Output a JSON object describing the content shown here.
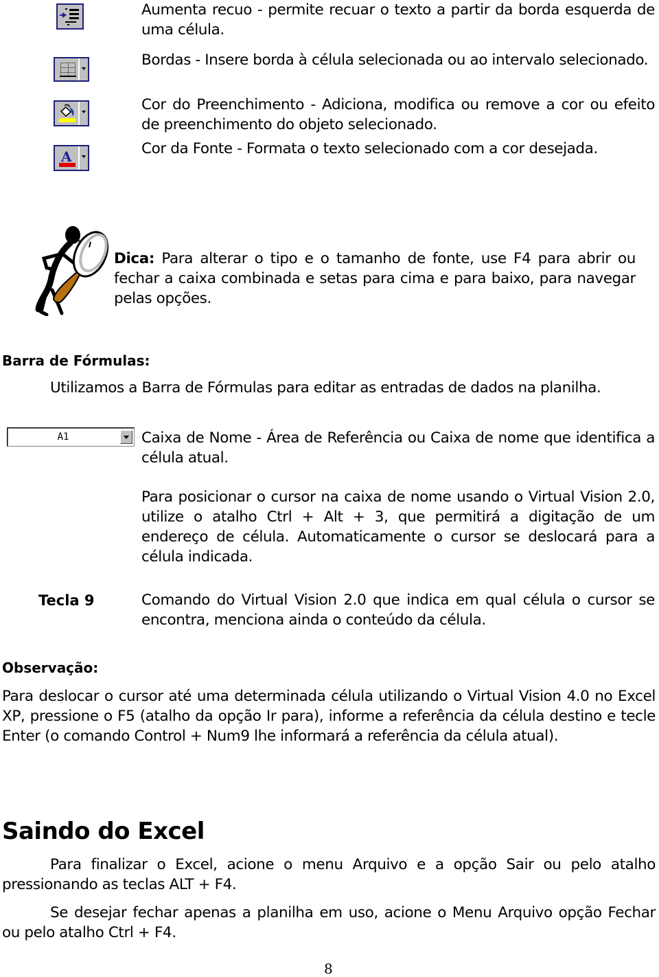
{
  "toolbar_items": [
    {
      "icon": "increase-indent-icon",
      "text": "Aumenta recuo - permite recuar o texto a partir da borda esquerda de uma célula."
    },
    {
      "icon": "borders-icon",
      "text": "Bordas - Insere borda à célula selecionada ou ao intervalo selecionado."
    },
    {
      "icon": "fill-color-icon",
      "text": "Cor do Preenchimento - Adiciona, modifica ou remove a cor ou efeito de preenchimento do objeto selecionado."
    },
    {
      "icon": "font-color-icon",
      "text": "Cor da Fonte - Formata o texto selecionado com a cor desejada."
    }
  ],
  "tip": {
    "icon": "magnifier-figure-icon",
    "label": "Dica:",
    "text": " Para alterar o tipo e o tamanho de fonte, use F4 para abrir ou fechar a caixa combinada e setas para cima e para baixo, para navegar pelas opções."
  },
  "formula_bar": {
    "heading": "Barra de Fórmulas:",
    "intro": "Utilizamos a Barra de Fórmulas para editar as entradas de dados na planilha.",
    "name_box_value": "A1",
    "name_box_desc": "Caixa de Nome - Área de Referência ou Caixa de nome que identifica a célula atual.",
    "name_box_tip": "Para posicionar o cursor na caixa de nome usando o Virtual Vision 2.0, utilize o atalho Ctrl + Alt + 3, que permitirá a digitação de um endereço de célula. Automaticamente o cursor se deslocará para a célula indicada.",
    "key_label": "Tecla 9",
    "key_desc": "Comando do Virtual Vision 2.0 que indica em qual célula o cursor se encontra, menciona ainda o conteúdo da célula."
  },
  "observation": {
    "heading": "Observação:",
    "text": "Para deslocar o cursor até uma determinada célula utilizando o Virtual Vision 4.0 no Excel XP, pressione o F5 (atalho da opção Ir para), informe a referência da célula destino e tecle Enter (o comando Control + Num9 lhe informará a referência da célula atual)."
  },
  "exit_section": {
    "heading": "Saindo do Excel",
    "para1": "Para finalizar o Excel, acione o menu Arquivo e a opção Sair ou pelo atalho pressionando as teclas ALT + F4.",
    "para2": "Se desejar fechar apenas a planilha em uso, acione o Menu Arquivo opção Fechar ou pelo atalho Ctrl + F4."
  },
  "page_number": "8",
  "colors": {
    "icon_border": "#1d1f7a",
    "icon_face": "#c0c0c0",
    "fill_yellow": "#ffff00",
    "font_red": "#e00000",
    "handle_brown": "#b5700f"
  }
}
